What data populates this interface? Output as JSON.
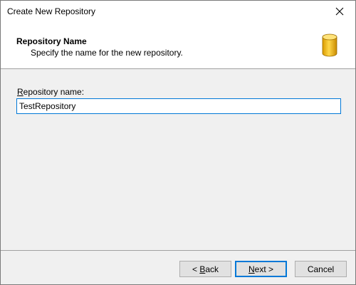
{
  "window": {
    "title": "Create New Repository"
  },
  "header": {
    "title": "Repository Name",
    "subtitle": "Specify the name for the new repository.",
    "icon": "database-icon",
    "icon_color": "#f2c230"
  },
  "form": {
    "name_label_mnemonic": "R",
    "name_label_rest": "epository name:",
    "name_value": "TestRepository"
  },
  "buttons": {
    "back_prefix": "< ",
    "back_mnemonic": "B",
    "back_rest": "ack",
    "next_mnemonic": "N",
    "next_rest": "ext >",
    "cancel_label": "Cancel"
  },
  "colors": {
    "focus": "#0078d7",
    "background": "#f0f0f0"
  }
}
